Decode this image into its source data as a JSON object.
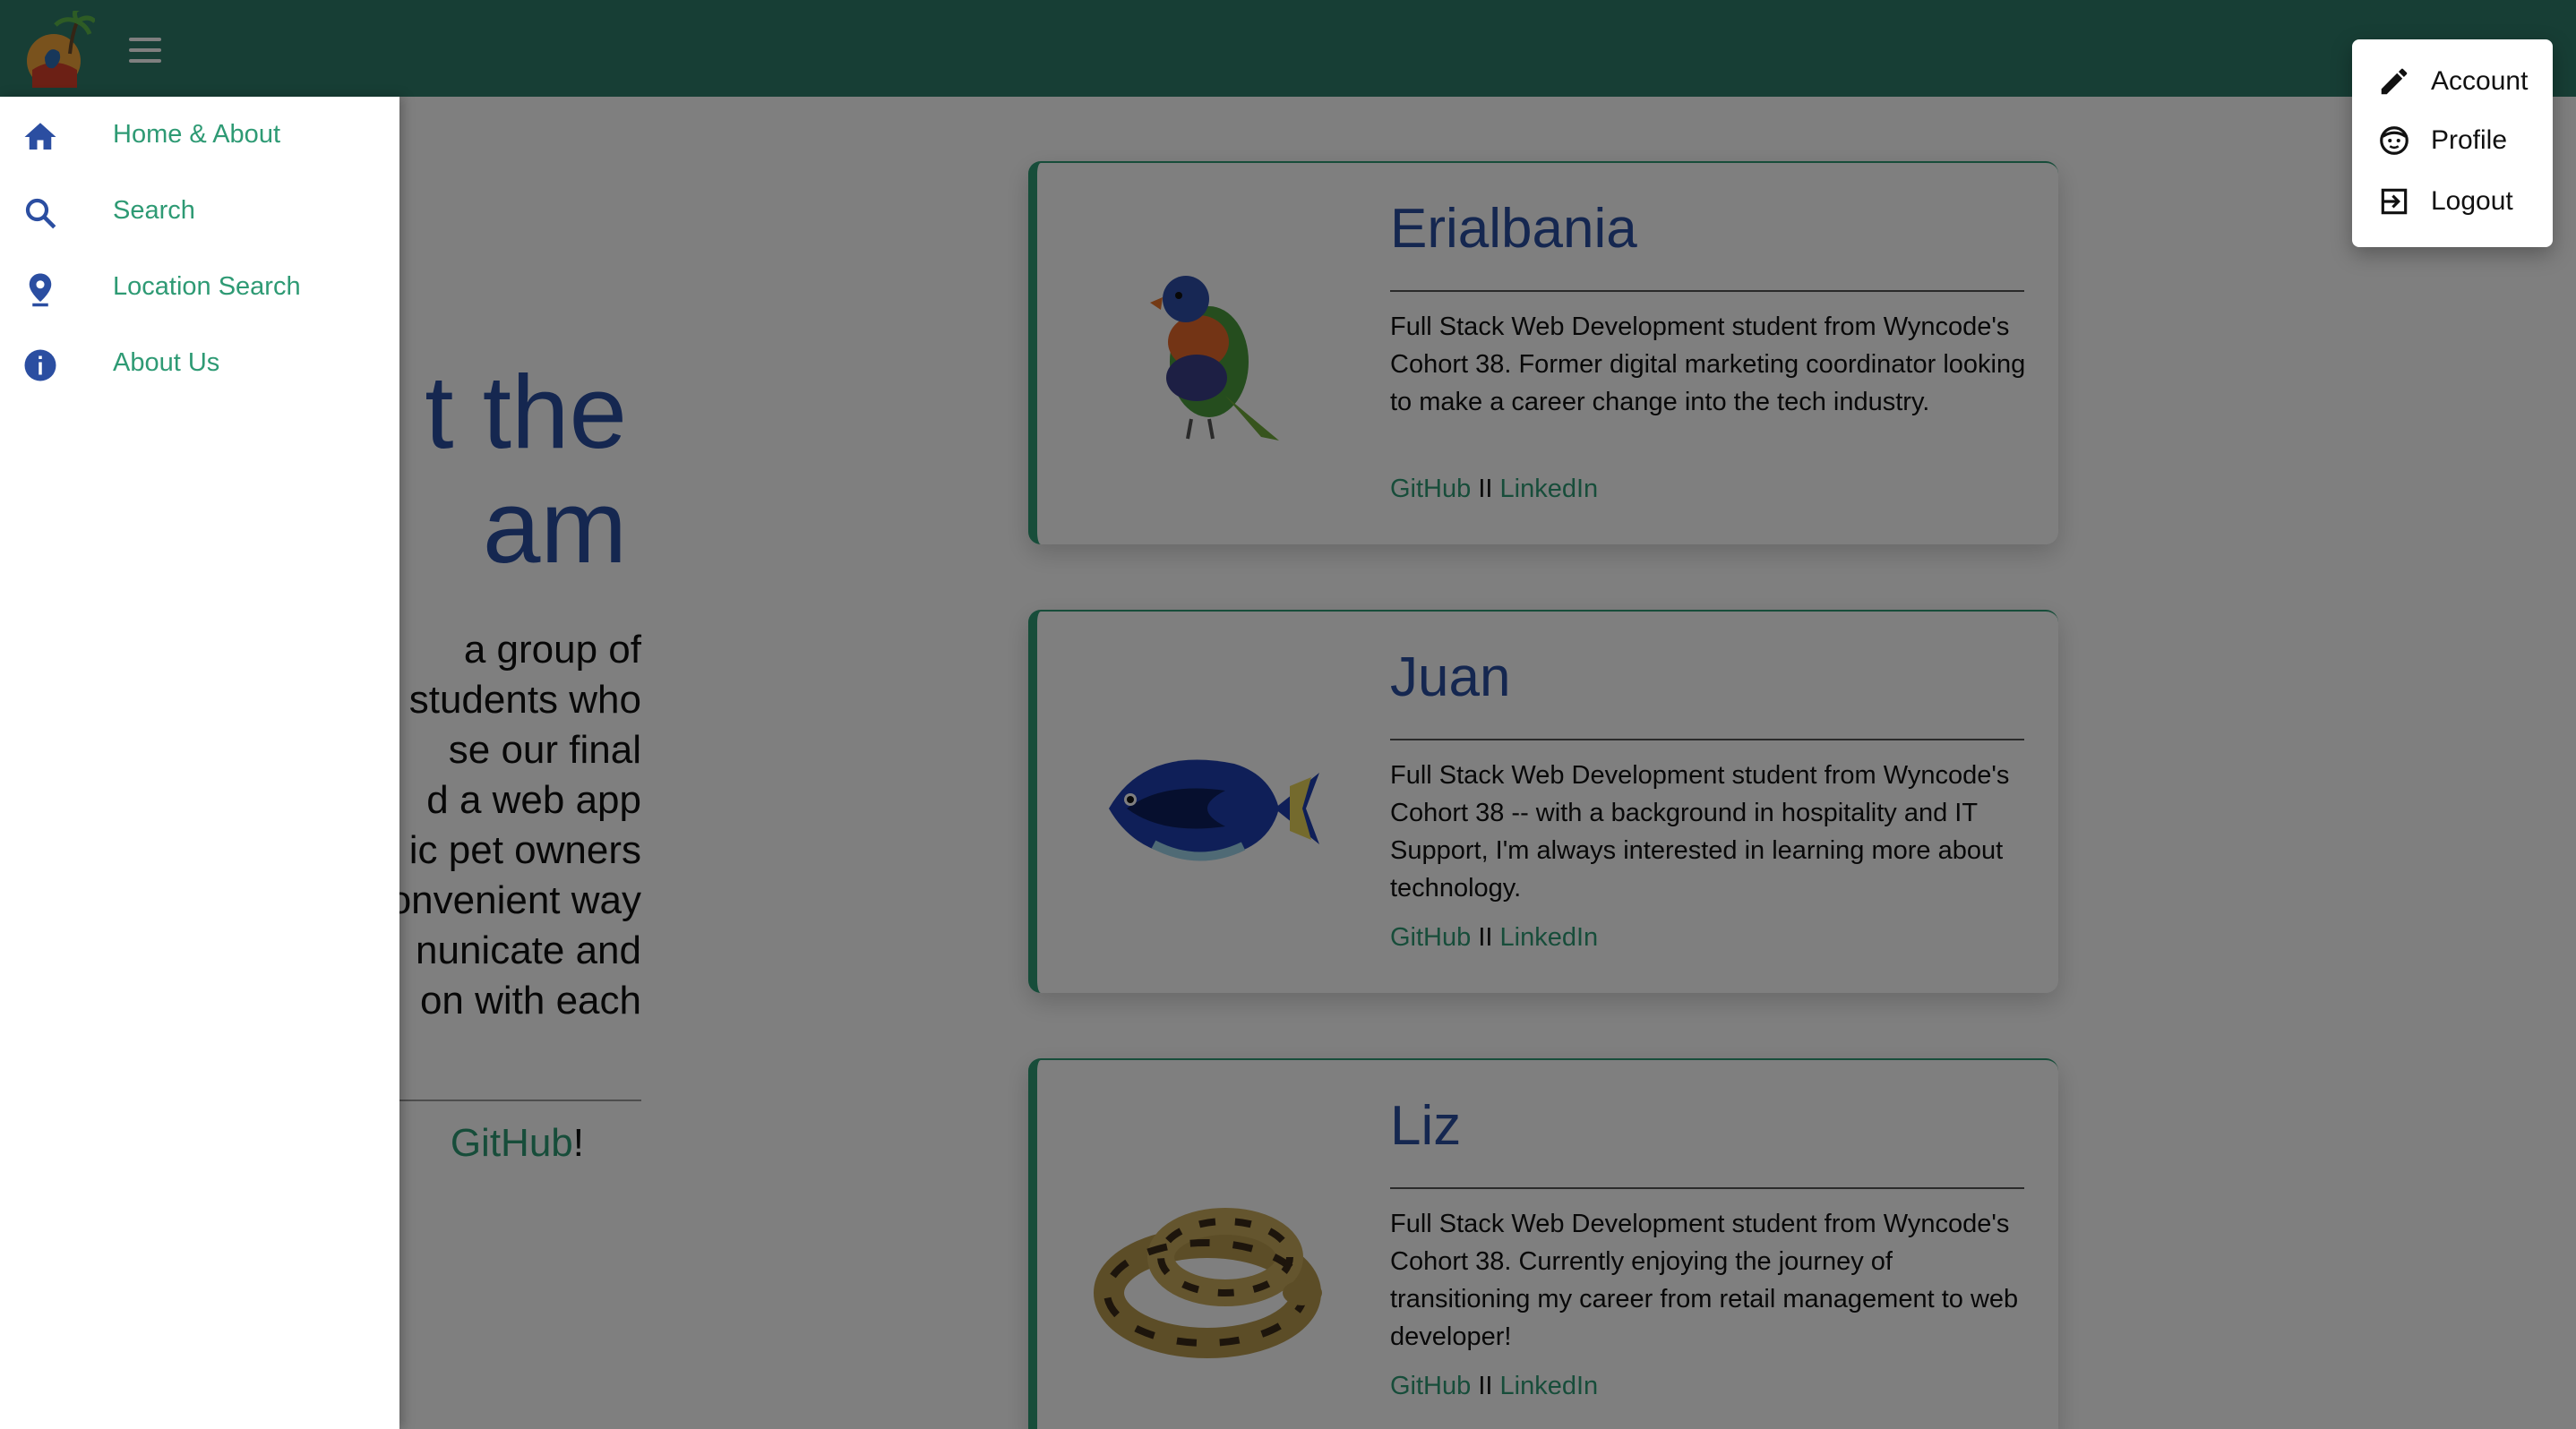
{
  "header": {
    "menu_icon": "hamburger-icon",
    "logo": "beach-parrot-logo"
  },
  "intro": {
    "heading_line1": "t the",
    "heading_line2": "am",
    "text_lines": [
      "a group of",
      "students who",
      "se our final",
      "d a web app",
      "ic pet owners",
      "onvenient way",
      "nunicate and",
      "on with each"
    ],
    "outro_link": "GitHub",
    "outro_suffix": "!"
  },
  "team": [
    {
      "name": "Erialbania",
      "image": "rainbow-lorikeet",
      "description": "Full Stack Web Development student from Wyncode's Cohort 38. Former digital marketing coordinator looking to make a career change into the tech industry.",
      "github": "GitHub",
      "separator": "II",
      "linkedin": "LinkedIn"
    },
    {
      "name": "Juan",
      "image": "blue-tang-fish",
      "description": "Full Stack Web Development student from Wyncode's Cohort 38 -- with a background in hospitality and IT Support, I'm always interested in learning more about technology.",
      "github": "GitHub",
      "separator": "II",
      "linkedin": "LinkedIn"
    },
    {
      "name": "Liz",
      "image": "ball-python",
      "description": "Full Stack Web Development student from Wyncode's Cohort 38. Currently enjoying the journey of transitioning my career from retail management to web developer!",
      "github": "GitHub",
      "separator": "II",
      "linkedin": "LinkedIn"
    }
  ],
  "drawer": {
    "items": [
      {
        "label": "Home & About",
        "icon": "home-icon"
      },
      {
        "label": "Search",
        "icon": "search-icon"
      },
      {
        "label": "Location Search",
        "icon": "location-pin-icon"
      },
      {
        "label": "About Us",
        "icon": "info-icon"
      }
    ]
  },
  "account_menu": {
    "items": [
      {
        "label": "Account",
        "icon": "pencil-icon"
      },
      {
        "label": "Profile",
        "icon": "face-icon"
      },
      {
        "label": "Logout",
        "icon": "logout-icon"
      }
    ]
  },
  "colors": {
    "header": "#2e7d6b",
    "accent": "#2e9a74",
    "heading": "#2b4ea1",
    "icon_blue": "#2b4ea1"
  }
}
